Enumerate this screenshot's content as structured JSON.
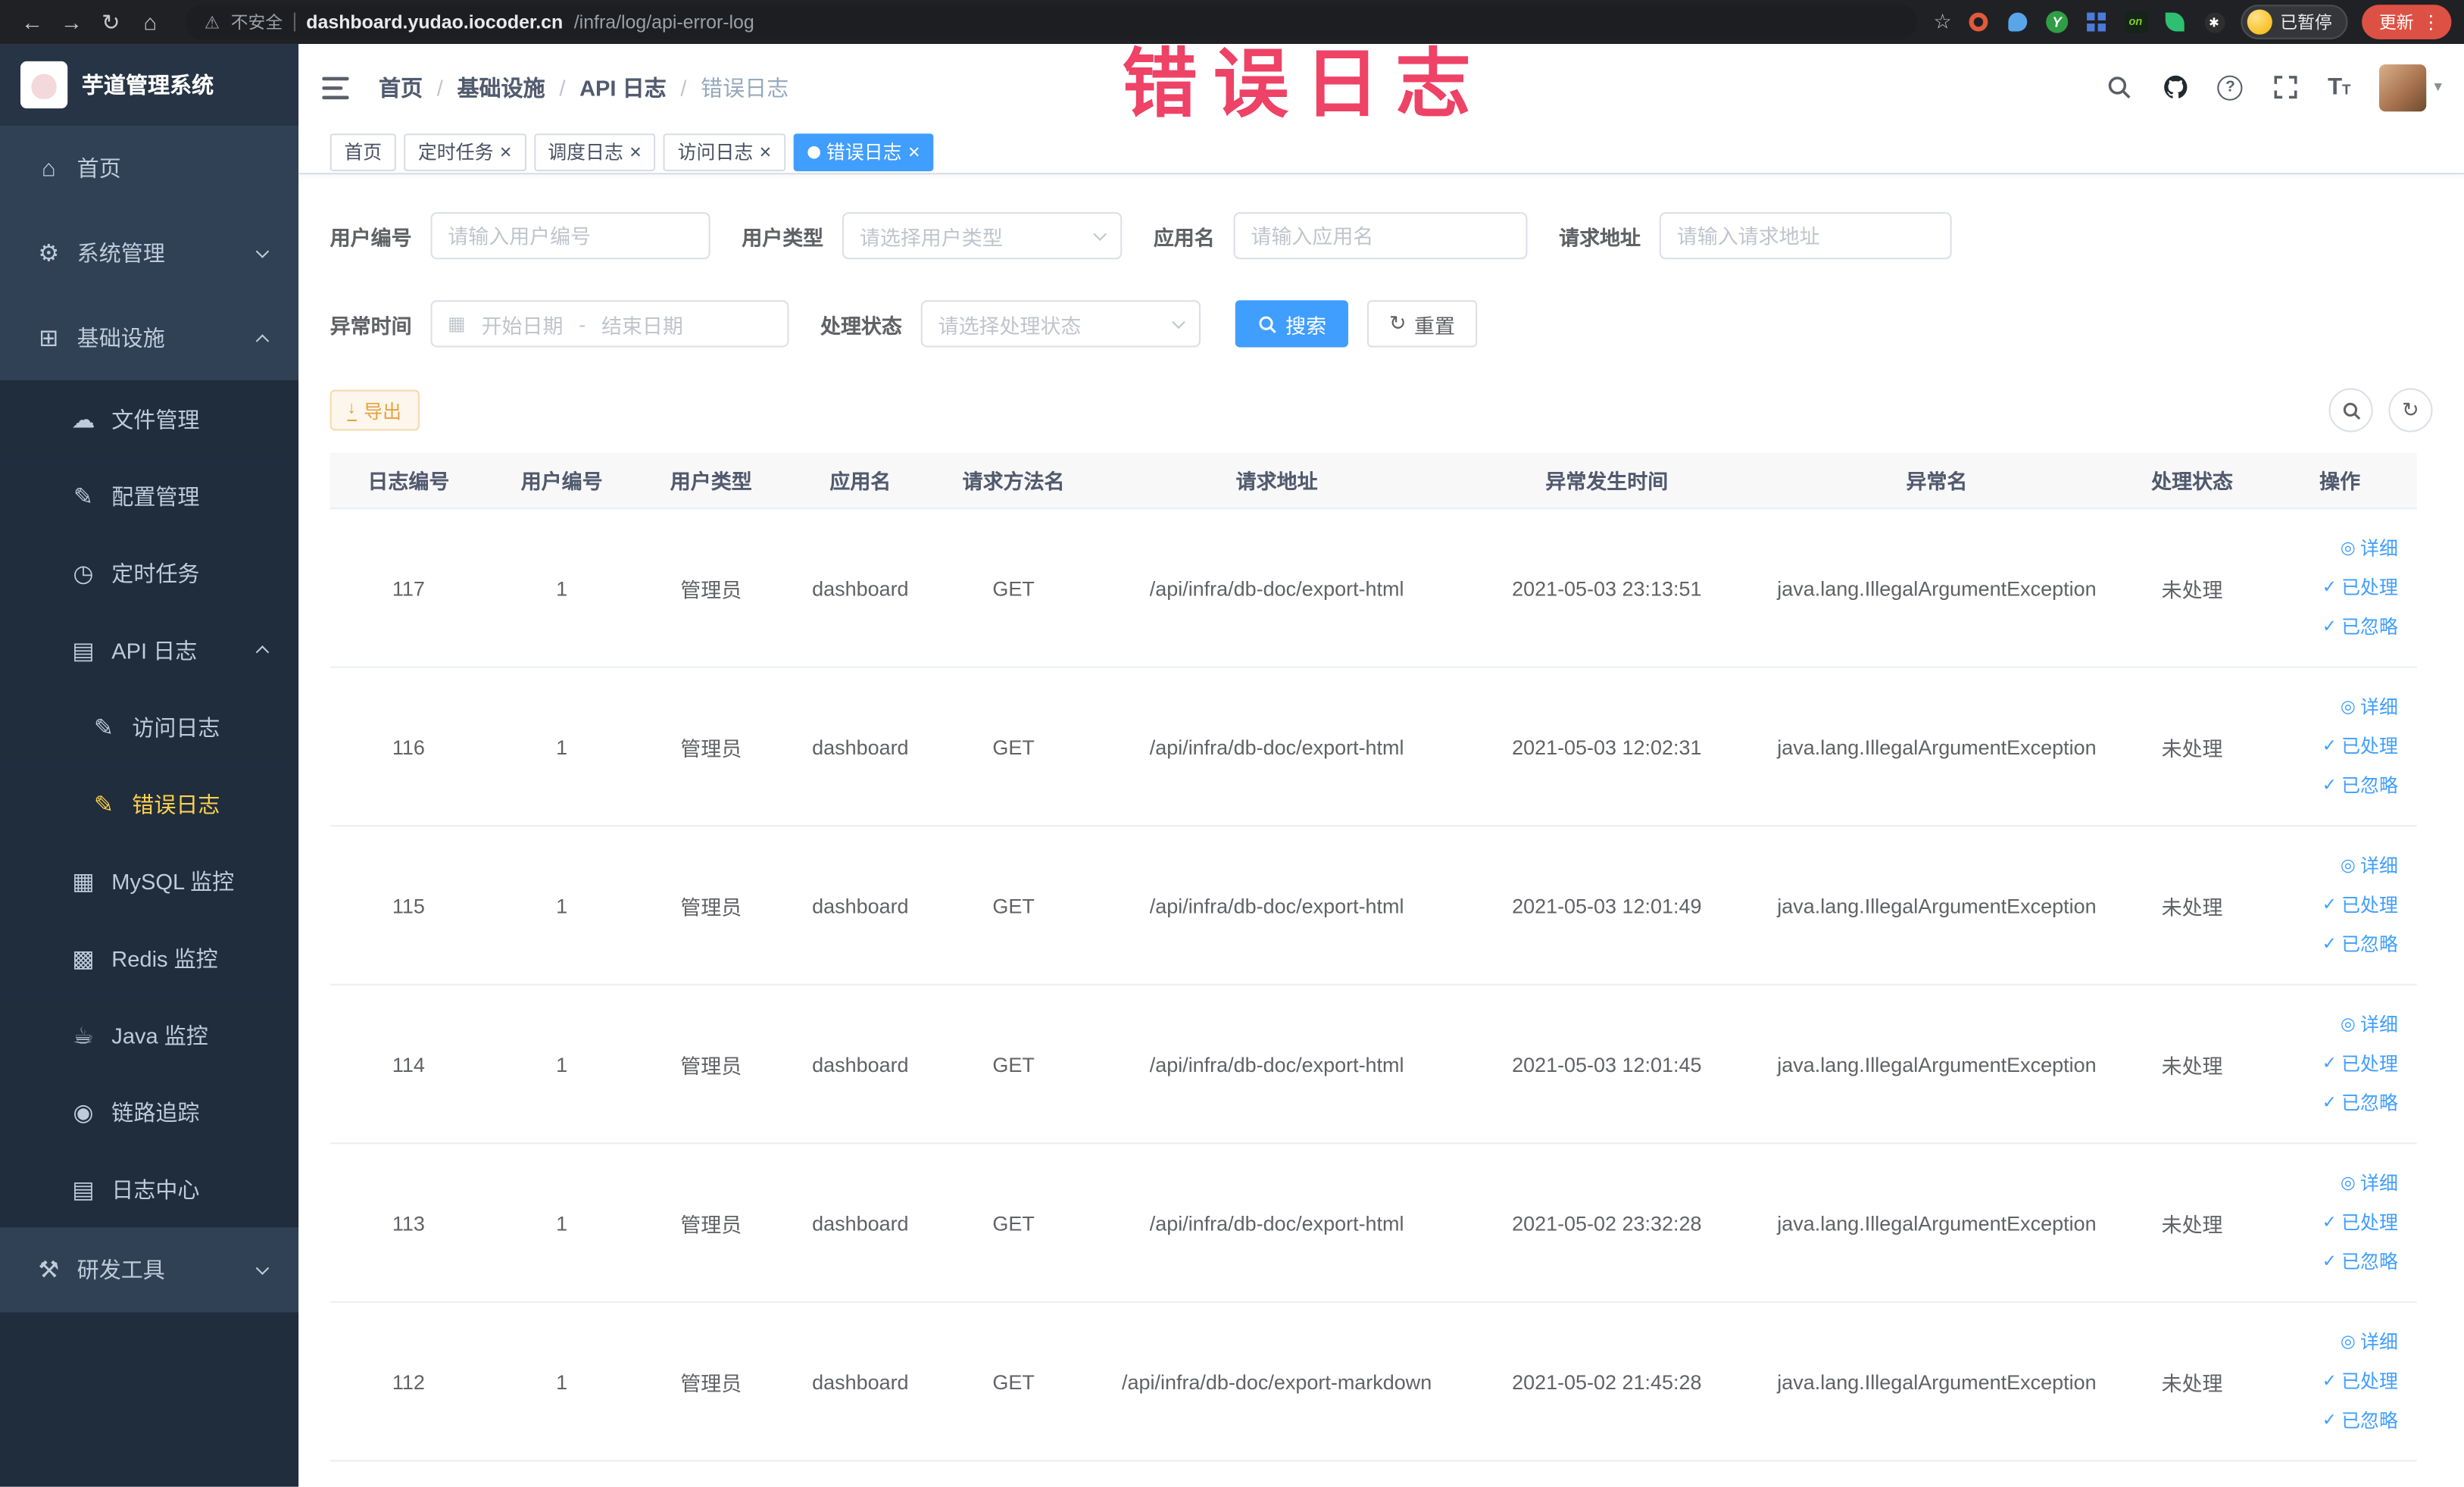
{
  "browser": {
    "security_label": "不安全",
    "url_host": "dashboard.yudao.iocoder.cn",
    "url_path": "/infra/log/api-error-log",
    "profile_badge": "已暂停",
    "update_button": "更新",
    "ext_y_label": "Y",
    "ext_on_label": "on",
    "ext_paw_label": "✱"
  },
  "annotation": {
    "text": "错误日志",
    "color": "#ee4266"
  },
  "icons": {
    "back": "←",
    "forward": "→",
    "reload": "↻",
    "home": "⌂",
    "warning": "⚠",
    "star": "☆",
    "kebab": "⋮",
    "caret": "▾",
    "close": "×",
    "check": "✓",
    "eye": "◎",
    "download": "↓",
    "calendar": "▦",
    "refresh": "↻",
    "question": "?"
  },
  "colors": {
    "primary": "#409eff",
    "sidebar_active": "#ffd04b",
    "warning": "#e6a23c",
    "link": "#409eff",
    "annotation": "#ee4266"
  },
  "sidebar": {
    "logo_title": "芋道管理系统",
    "menu": [
      {
        "label": "首页",
        "glyph": "⌂"
      },
      {
        "label": "系统管理",
        "glyph": "⚙"
      },
      {
        "label": "基础设施",
        "glyph": "⊞"
      },
      {
        "label": "文件管理",
        "glyph": "☁"
      },
      {
        "label": "配置管理",
        "glyph": "✎"
      },
      {
        "label": "定时任务",
        "glyph": "◷"
      },
      {
        "label": "API 日志",
        "glyph": "▤"
      },
      {
        "label": "访问日志",
        "glyph": "✎"
      },
      {
        "label": "错误日志",
        "glyph": "✎"
      },
      {
        "label": "MySQL 监控",
        "glyph": "▦"
      },
      {
        "label": "Redis 监控",
        "glyph": "▩"
      },
      {
        "label": "Java 监控",
        "glyph": "☕"
      },
      {
        "label": "链路追踪",
        "glyph": "◉"
      },
      {
        "label": "日志中心",
        "glyph": "▤"
      },
      {
        "label": "研发工具",
        "glyph": "⚒"
      }
    ]
  },
  "header": {
    "breadcrumb": [
      "首页",
      "基础设施",
      "API 日志",
      "错误日志"
    ],
    "breadcrumb_separator": "/"
  },
  "tabs": [
    {
      "label": "首页"
    },
    {
      "label": "定时任务"
    },
    {
      "label": "调度日志"
    },
    {
      "label": "访问日志"
    },
    {
      "label": "错误日志"
    }
  ],
  "filters": {
    "user_id": {
      "label": "用户编号",
      "placeholder": "请输入用户编号"
    },
    "user_type": {
      "label": "用户类型",
      "placeholder": "请选择用户类型"
    },
    "app_name": {
      "label": "应用名",
      "placeholder": "请输入应用名"
    },
    "request_url": {
      "label": "请求地址",
      "placeholder": "请输入请求地址"
    },
    "exception_time": {
      "label": "异常时间",
      "start_placeholder": "开始日期",
      "separator": "-",
      "end_placeholder": "结束日期"
    },
    "process_status": {
      "label": "处理状态",
      "placeholder": "请选择处理状态"
    },
    "search_button": "搜索",
    "reset_button": "重置"
  },
  "toolbar": {
    "export_button": "导出"
  },
  "table": {
    "columns": [
      "日志编号",
      "用户编号",
      "用户类型",
      "应用名",
      "请求方法名",
      "请求地址",
      "异常发生时间",
      "异常名",
      "处理状态",
      "操作"
    ],
    "action_labels": [
      "详细",
      "已处理",
      "已忽略"
    ],
    "rows": [
      {
        "log_id": "117",
        "user_id": "1",
        "user_type": "管理员",
        "app_name": "dashboard",
        "method": "GET",
        "request_url": "/api/infra/db-doc/export-html",
        "time": "2021-05-03 23:13:51",
        "exception_name": "java.lang.IllegalArgumentException",
        "status": "未处理"
      },
      {
        "log_id": "116",
        "user_id": "1",
        "user_type": "管理员",
        "app_name": "dashboard",
        "method": "GET",
        "request_url": "/api/infra/db-doc/export-html",
        "time": "2021-05-03 12:02:31",
        "exception_name": "java.lang.IllegalArgumentException",
        "status": "未处理"
      },
      {
        "log_id": "115",
        "user_id": "1",
        "user_type": "管理员",
        "app_name": "dashboard",
        "method": "GET",
        "request_url": "/api/infra/db-doc/export-html",
        "time": "2021-05-03 12:01:49",
        "exception_name": "java.lang.IllegalArgumentException",
        "status": "未处理"
      },
      {
        "log_id": "114",
        "user_id": "1",
        "user_type": "管理员",
        "app_name": "dashboard",
        "method": "GET",
        "request_url": "/api/infra/db-doc/export-html",
        "time": "2021-05-03 12:01:45",
        "exception_name": "java.lang.IllegalArgumentException",
        "status": "未处理"
      },
      {
        "log_id": "113",
        "user_id": "1",
        "user_type": "管理员",
        "app_name": "dashboard",
        "method": "GET",
        "request_url": "/api/infra/db-doc/export-html",
        "time": "2021-05-02 23:32:28",
        "exception_name": "java.lang.IllegalArgumentException",
        "status": "未处理"
      },
      {
        "log_id": "112",
        "user_id": "1",
        "user_type": "管理员",
        "app_name": "dashboard",
        "method": "GET",
        "request_url": "/api/infra/db-doc/export-markdown",
        "time": "2021-05-02 21:45:28",
        "exception_name": "java.lang.IllegalArgumentException",
        "status": "未处理"
      }
    ]
  }
}
